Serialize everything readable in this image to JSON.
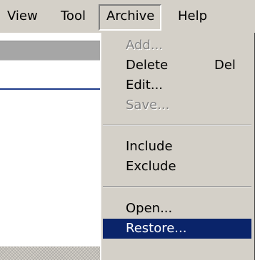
{
  "menubar": {
    "items": [
      {
        "label": "View"
      },
      {
        "label": "Tool"
      },
      {
        "label": "Archive"
      },
      {
        "label": "Help"
      }
    ]
  },
  "archive_menu": {
    "items": [
      {
        "label": "Add...",
        "enabled": false
      },
      {
        "label": "Delete",
        "shortcut": "Del",
        "enabled": true
      },
      {
        "label": "Edit...",
        "enabled": true
      },
      {
        "label": "Save...",
        "enabled": false
      },
      {
        "label": "Include",
        "enabled": true
      },
      {
        "label": "Exclude",
        "enabled": true
      },
      {
        "label": "Open...",
        "enabled": true
      },
      {
        "label": "Restore...",
        "enabled": true,
        "selected": true
      }
    ]
  },
  "colors": {
    "menu_background": "#d4d0c8",
    "selection_background": "#0a246a",
    "selection_text": "#ffffff",
    "disabled_text": "#808080",
    "window_line": "#1e3b8a"
  }
}
